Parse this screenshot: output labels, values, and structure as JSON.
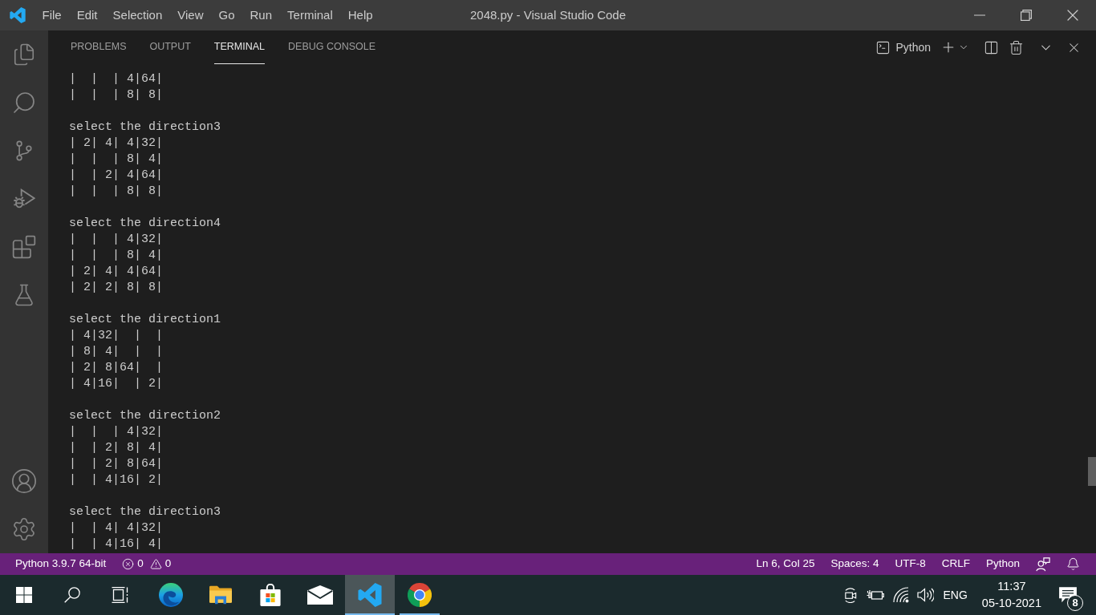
{
  "title_bar": {
    "menu": [
      "File",
      "Edit",
      "Selection",
      "View",
      "Go",
      "Run",
      "Terminal",
      "Help"
    ],
    "title": "2048.py - Visual Studio Code"
  },
  "panel": {
    "tabs": [
      {
        "label": "PROBLEMS",
        "selected": false
      },
      {
        "label": "OUTPUT",
        "selected": false
      },
      {
        "label": "TERMINAL",
        "selected": true
      },
      {
        "label": "DEBUG CONSOLE",
        "selected": false
      }
    ],
    "terminal_selector": "Python",
    "terminal": {
      "blocks": [
        {
          "rows": [
            "|  |  | 4|64|",
            "|  |  | 8| 8|"
          ]
        },
        {
          "prompt": "select the direction3",
          "rows": [
            "| 2| 4| 4|32|",
            "|  |  | 8| 4|",
            "|  | 2| 4|64|",
            "|  |  | 8| 8|"
          ]
        },
        {
          "prompt": "select the direction4",
          "rows": [
            "|  |  | 4|32|",
            "|  |  | 8| 4|",
            "| 2| 4| 4|64|",
            "| 2| 2| 8| 8|"
          ]
        },
        {
          "prompt": "select the direction1",
          "rows": [
            "| 4|32|  |  |",
            "| 8| 4|  |  |",
            "| 2| 8|64|  |",
            "| 4|16|  | 2|"
          ]
        },
        {
          "prompt": "select the direction2",
          "rows": [
            "|  |  | 4|32|",
            "|  | 2| 8| 4|",
            "|  | 2| 8|64|",
            "|  | 4|16| 2|"
          ]
        },
        {
          "prompt": "select the direction3",
          "rows": [
            "|  | 4| 4|32|",
            "|  | 4|16| 4|"
          ]
        }
      ]
    }
  },
  "status_bar": {
    "interpreter": "Python 3.9.7 64-bit",
    "errors": "0",
    "warnings": "0",
    "items": [
      "Ln 6, Col 25",
      "Spaces: 4",
      "UTF-8",
      "CRLF",
      "Python"
    ]
  },
  "taskbar": {
    "apps": [
      {
        "kind": "wave",
        "selected": false,
        "running": false
      },
      {
        "kind": "folder",
        "selected": false,
        "running": false
      },
      {
        "kind": "bag",
        "selected": false,
        "running": false
      },
      {
        "kind": "mail",
        "selected": false,
        "running": false
      },
      {
        "kind": "editor",
        "selected": true,
        "running": true
      },
      {
        "kind": "ring",
        "selected": false,
        "running": true
      }
    ],
    "language": "ENG",
    "time": "11:37",
    "date": "05-10-2021",
    "notifications": "8"
  }
}
